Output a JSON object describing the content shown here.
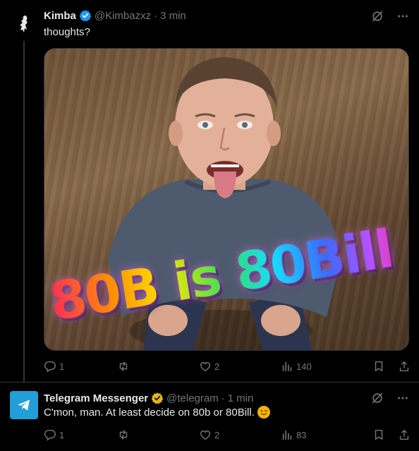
{
  "colors": {
    "background": "#000000",
    "text": "#e7e9ea",
    "muted": "#71767b",
    "verified_blue": "#1d9bf0",
    "verified_gold": "#e2b719",
    "telegram_blue": "#229ed9"
  },
  "tweets": [
    {
      "author_name": "Kimba",
      "handle": "@Kimbazxz",
      "separator": "·",
      "time": "3 min",
      "badge": "verified-blue-badge-icon",
      "text": "thoughts?",
      "media": {
        "overlay_text": "80B is 80Bill"
      },
      "stats": {
        "replies": "1",
        "retweets": "",
        "likes": "2",
        "views": "140"
      }
    },
    {
      "author_name": "Telegram Messenger",
      "handle": "@telegram",
      "separator": "·",
      "time": "1 min",
      "badge": "verified-gold-badge-icon",
      "text": "C'mon, man. At least decide on 80b or 80Bill.",
      "emoji": "winking-face-emoji",
      "stats": {
        "replies": "1",
        "retweets": "",
        "likes": "2",
        "views": "83"
      }
    }
  ]
}
